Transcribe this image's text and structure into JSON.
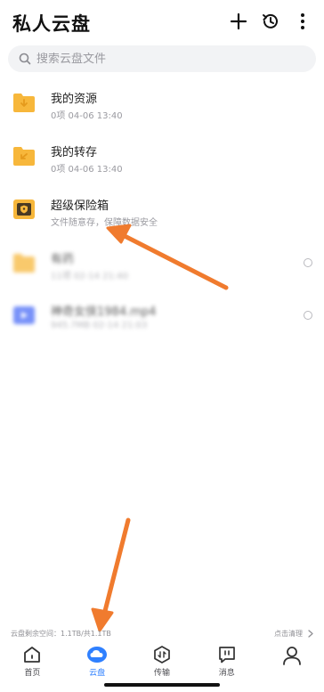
{
  "header": {
    "title": "私人云盘"
  },
  "search": {
    "placeholder": "搜索云盘文件"
  },
  "files": [
    {
      "name": "我的资源",
      "meta": "0项 04-06 13:40",
      "icon": "download-folder-icon"
    },
    {
      "name": "我的转存",
      "meta": "0项 04-06 13:40",
      "icon": "transfer-folder-icon"
    },
    {
      "name": "超级保险箱",
      "meta": "文件随意存，保障数据安全",
      "icon": "safe-box-icon"
    },
    {
      "name": "有药",
      "meta": "11项 02-14 21:40",
      "icon": "folder-icon"
    },
    {
      "name": "神奇女侠1984.mp4",
      "meta": "945.7MB 02-14 21:03",
      "icon": "video-file-icon"
    }
  ],
  "storage": {
    "text": "云盘剩余空间：1.1TB/共1.1TB",
    "clean_label": "点击清理"
  },
  "tabs": [
    {
      "label": "首页",
      "icon": "home-icon"
    },
    {
      "label": "云盘",
      "icon": "cloud-icon",
      "active": true
    },
    {
      "label": "传输",
      "icon": "transfer-icon"
    },
    {
      "label": "消息",
      "icon": "message-icon"
    },
    {
      "label": "",
      "icon": "profile-icon"
    }
  ],
  "colors": {
    "accent": "#2f80ff",
    "folder": "#f7b73b",
    "annotation_arrow": "#f07b2e"
  }
}
